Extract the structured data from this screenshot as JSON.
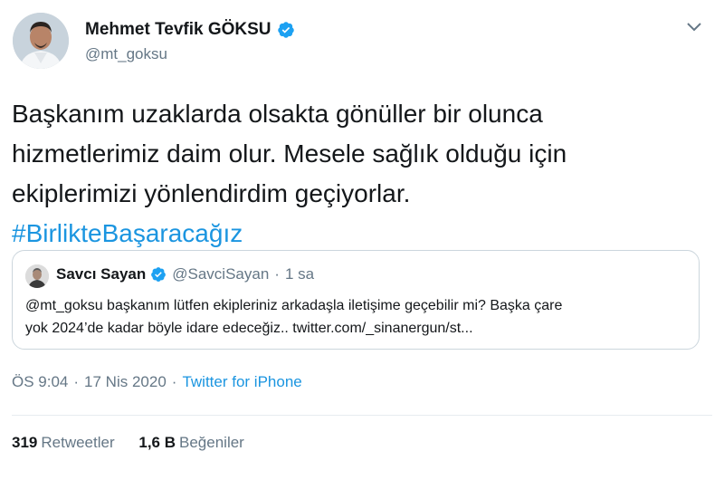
{
  "author": {
    "name": "Mehmet Tevfik GÖKSU",
    "handle": "@mt_goksu",
    "verified_icon": "verified-badge-icon"
  },
  "tweet": {
    "lines": [
      "Başkanım uzaklarda olsakta gönüller bir olunca",
      "hizmetlerimiz daim olur. Mesele sağlık olduğu için",
      "ekiplerimizi yönlendirdim geçiyorlar."
    ],
    "hashtag": "#BirlikteBaşaracağız"
  },
  "quoted": {
    "name": "Savcı Sayan",
    "handle": "@SavciSayan",
    "separator": "·",
    "time": "1 sa",
    "text_line1": "@mt_goksu başkanım lütfen ekipleriniz arkadaşla iletişime geçebilir mi? Başka çare",
    "text_line2": "yok 2024’de kadar böyle idare edeceğiz.. twitter.com/_sinanergun/st..."
  },
  "meta": {
    "time": "ÖS 9:04",
    "separator": "·",
    "date": "17 Nis 2020",
    "source": "Twitter for iPhone"
  },
  "stats": {
    "retweets_count": "319",
    "retweets_label": "Retweetler",
    "likes_count": "1,6 B",
    "likes_label": "Beğeniler"
  },
  "colors": {
    "accent": "#1b95e0",
    "secondary_text": "#657786",
    "border": "#ccd6dd"
  }
}
